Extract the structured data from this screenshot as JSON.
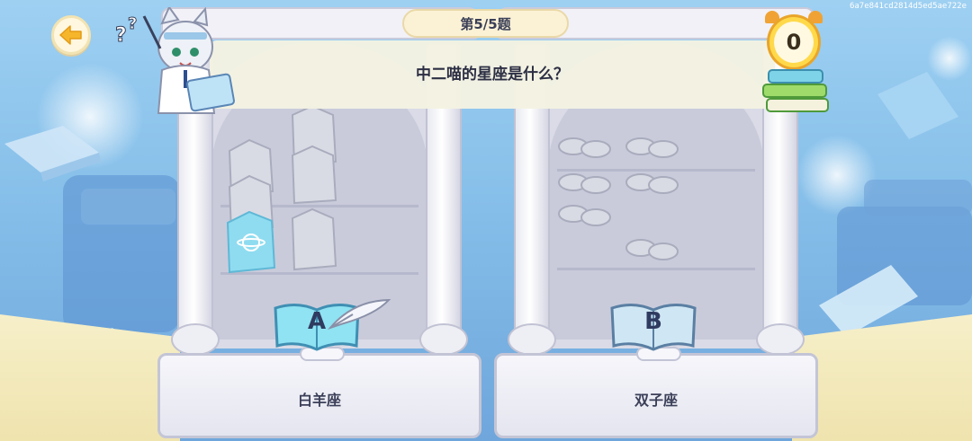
{
  "session_id": "6a7e841cd2814d5ed5ae722e",
  "progress": "第5/5题",
  "question": "中二喵的星座是什么？",
  "timer_value": "0",
  "options": [
    {
      "letter": "A",
      "answer": "白羊座"
    },
    {
      "letter": "B",
      "answer": "双子座"
    }
  ],
  "colors": {
    "sky": "#86bfe9",
    "banner": "#f4f2e2",
    "book_a": "#8fe3f2",
    "book_b": "#cfe7f4",
    "timer": "#ffd94a",
    "text": "#2d2f44"
  }
}
